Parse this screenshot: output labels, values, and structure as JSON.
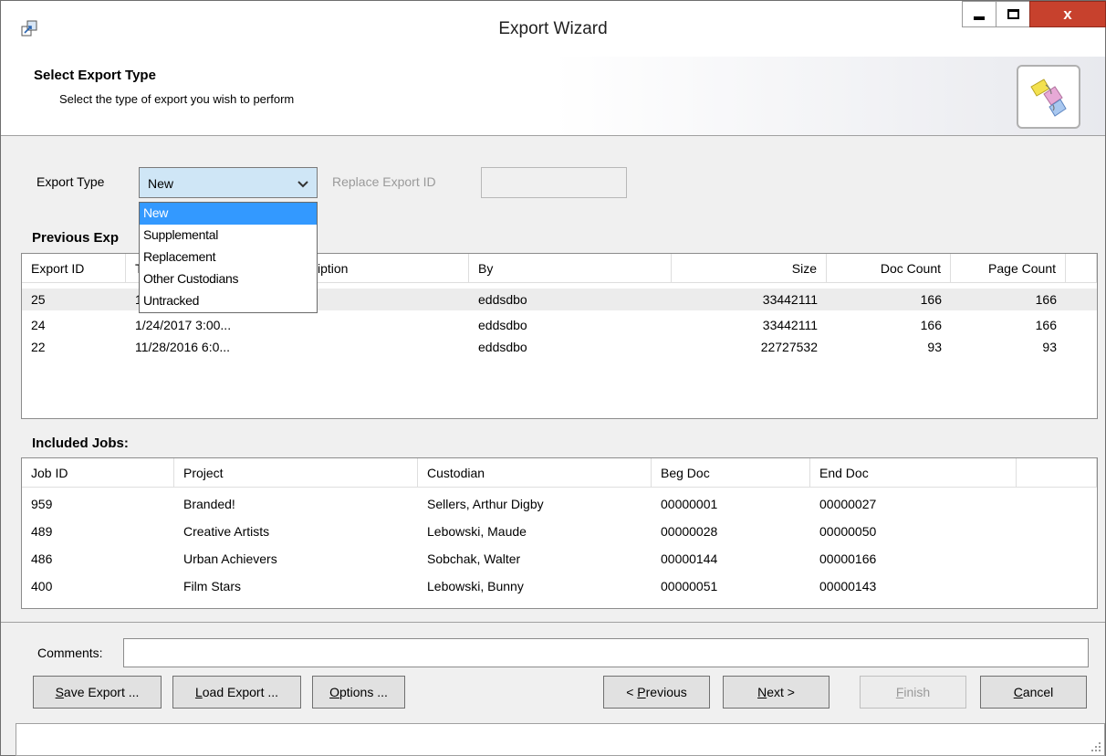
{
  "window": {
    "title": "Export Wizard",
    "close_glyph": "x"
  },
  "header": {
    "title": "Select Export Type",
    "subtitle": "Select the type of export you wish to perform"
  },
  "export_type": {
    "label": "Export Type",
    "selected": "New",
    "options": [
      "New",
      "Supplemental",
      "Replacement",
      "Other Custodians",
      "Untracked"
    ],
    "replace_label": "Replace Export ID",
    "replace_value": ""
  },
  "previous_exports": {
    "label": "Previous Exp",
    "columns": [
      "Export ID",
      "T",
      "iption",
      "By",
      "Size",
      "Doc Count",
      "Page Count"
    ],
    "rows": [
      {
        "id": "25",
        "date": "1",
        "by": "eddsdbo",
        "size": "33442111",
        "doc_count": "166",
        "page_count": "166"
      },
      {
        "id": "24",
        "date": "1/24/2017 3:00...",
        "by": "eddsdbo",
        "size": "33442111",
        "doc_count": "166",
        "page_count": "166"
      },
      {
        "id": "22",
        "date": "11/28/2016 6:0...",
        "by": "eddsdbo",
        "size": "22727532",
        "doc_count": "93",
        "page_count": "93"
      }
    ]
  },
  "included_jobs": {
    "label": "Included Jobs:",
    "columns": [
      "Job ID",
      "Project",
      "Custodian",
      "Beg Doc",
      "End Doc"
    ],
    "rows": [
      {
        "job": "959",
        "project": "Branded!",
        "custodian": "Sellers, Arthur Digby",
        "beg": "00000001",
        "end": "00000027"
      },
      {
        "job": "489",
        "project": "Creative Artists",
        "custodian": "Lebowski, Maude",
        "beg": "00000028",
        "end": "00000050"
      },
      {
        "job": "486",
        "project": "Urban Achievers",
        "custodian": "Sobchak, Walter",
        "beg": "00000144",
        "end": "00000166"
      },
      {
        "job": "400",
        "project": "Film Stars",
        "custodian": "Lebowski, Bunny",
        "beg": "00000051",
        "end": "00000143"
      }
    ]
  },
  "comments": {
    "label": "Comments:",
    "value": ""
  },
  "buttons": {
    "save_key": "S",
    "save_rest": "ave Export ...",
    "load_key": "L",
    "load_rest": "oad Export ...",
    "options_key": "O",
    "options_rest": "ptions ...",
    "previous_pre": "< ",
    "previous_key": "P",
    "previous_rest": "revious",
    "next_key": "N",
    "next_rest": "ext >",
    "finish_key": "F",
    "finish_rest": "inish",
    "cancel_key": "C",
    "cancel_rest": "ancel"
  },
  "icons": {
    "app": "export-app-icon",
    "header": "export-wizard-graphic-icon",
    "dropdown": "chevron-down-icon",
    "grip": "resize-grip-icon"
  }
}
